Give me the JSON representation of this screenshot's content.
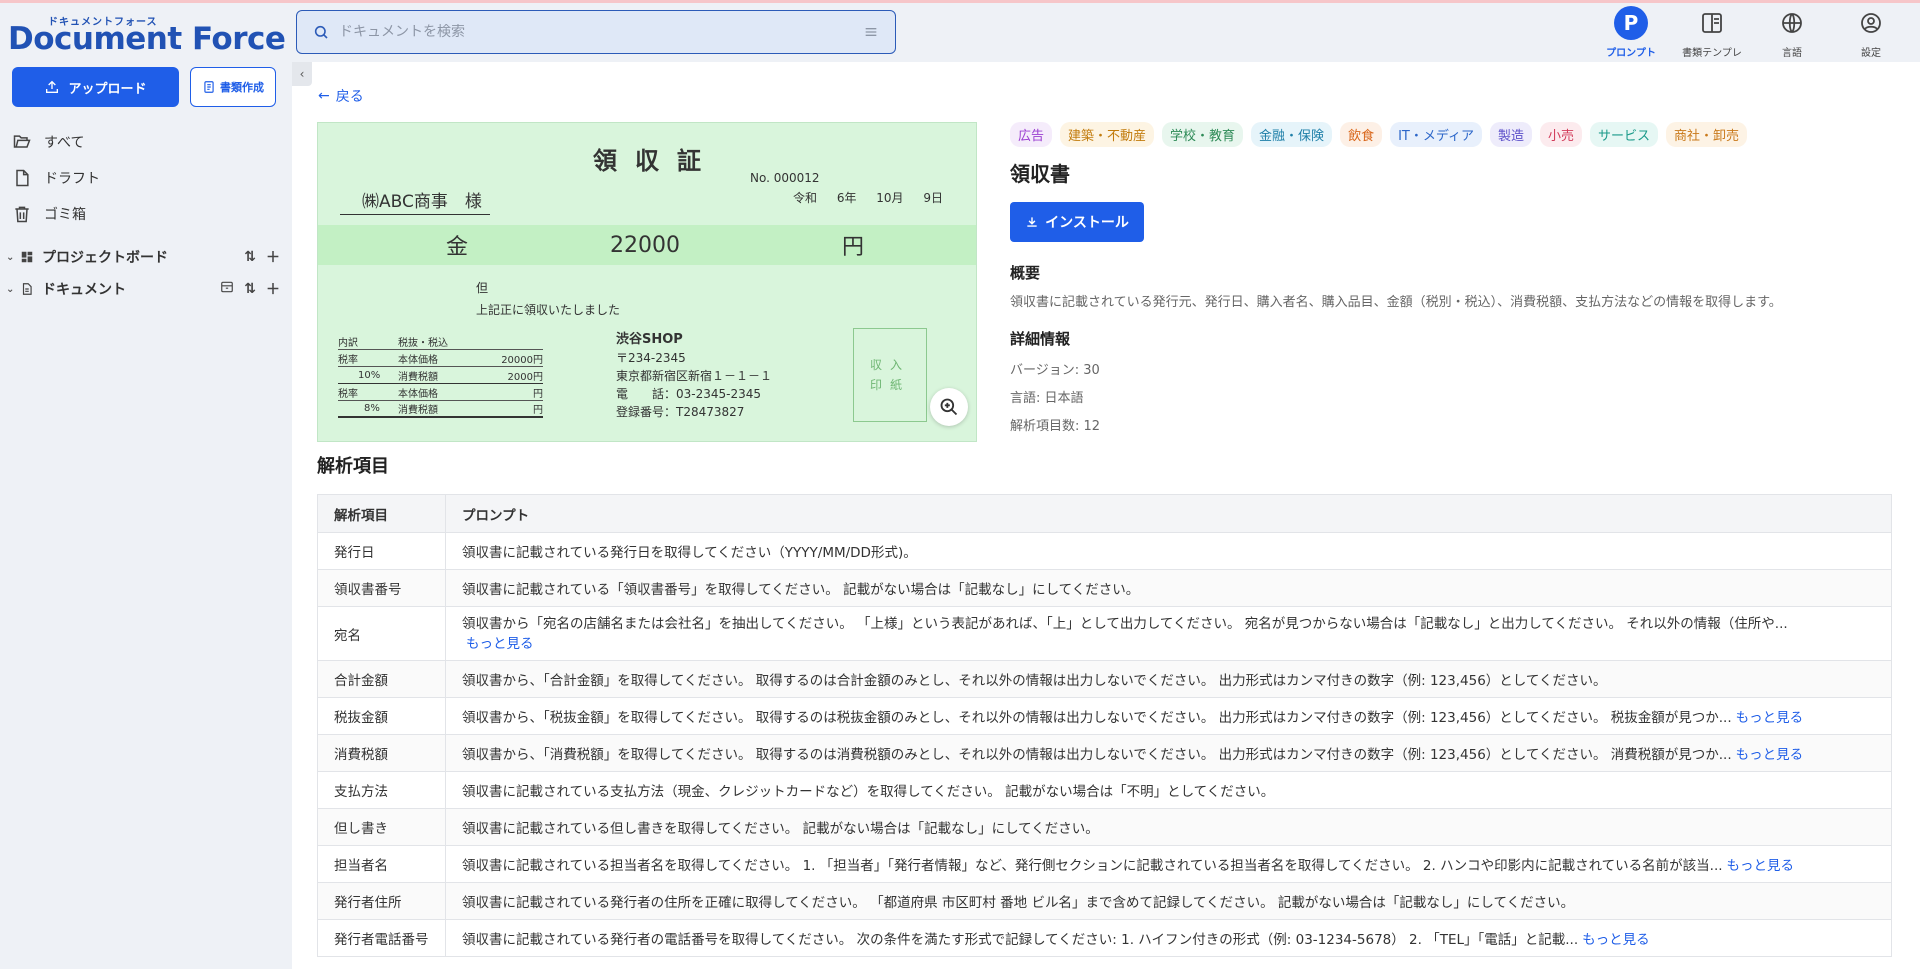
{
  "app": {
    "logo_kana": "ドキュメントフォース",
    "logo_main": "Document Force"
  },
  "sidebar": {
    "upload_label": "アップロード",
    "create_label": "書類作成",
    "nav": [
      {
        "label": "すべて",
        "icon": "folder-open-icon"
      },
      {
        "label": "ドラフト",
        "icon": "file-icon"
      },
      {
        "label": "ゴミ箱",
        "icon": "trash-icon"
      }
    ],
    "tree": [
      {
        "label": "プロジェクトボード",
        "icon": "dashboard-icon"
      },
      {
        "label": "ドキュメント",
        "icon": "document-icon"
      }
    ]
  },
  "search": {
    "placeholder": "ドキュメントを検索"
  },
  "topnav": [
    {
      "label": "プロンプト",
      "icon": "prompt-icon",
      "active": true
    },
    {
      "label": "書類テンプレ",
      "icon": "template-icon"
    },
    {
      "label": "言語",
      "icon": "globe-icon"
    },
    {
      "label": "設定",
      "icon": "user-settings-icon"
    }
  ],
  "main": {
    "back_label": "戻る"
  },
  "receipt": {
    "title": "領収証",
    "no": "No.   000012",
    "date": "令和 6年 10月 9日",
    "to": "㈱ABC商事　様",
    "kin": "金",
    "amount": "22000",
    "yen": "円",
    "tadashi": "但",
    "received": "上記正に領収いたしました",
    "table": {
      "head": [
        "内訳",
        "税抜・税込",
        ""
      ],
      "rows": [
        [
          "税率",
          "本体価格",
          "20000円"
        ],
        [
          "10%",
          "消費税額",
          "2000円"
        ],
        [
          "税率",
          "本体価格",
          "円"
        ],
        [
          "8%",
          "消費税額",
          "円"
        ]
      ]
    },
    "shop": {
      "name": "渋谷SHOP",
      "zip": "〒234-2345",
      "address": "東京都新宿区新宿１－１－１",
      "tel": "電　　話：03-2345-2345",
      "reg": "登録番号：T28473827"
    },
    "stamp_line1": "収入",
    "stamp_line2": "印紙"
  },
  "details": {
    "tags": [
      {
        "label": "広告",
        "color": "#9b3fd1",
        "bg": "#f5ecfb"
      },
      {
        "label": "建築・不動産",
        "color": "#c27c0e",
        "bg": "#fdf4e3"
      },
      {
        "label": "学校・教育",
        "color": "#2e8b57",
        "bg": "#e8f6ee"
      },
      {
        "label": "金融・保険",
        "color": "#1f7fa8",
        "bg": "#e6f4fa"
      },
      {
        "label": "飲食",
        "color": "#d9661a",
        "bg": "#fdf0e6"
      },
      {
        "label": "IT・メディア",
        "color": "#2c66c9",
        "bg": "#e8f0fc"
      },
      {
        "label": "製造",
        "color": "#5b4fc9",
        "bg": "#eeecfb"
      },
      {
        "label": "小売",
        "color": "#d23c5a",
        "bg": "#fcebee"
      },
      {
        "label": "サービス",
        "color": "#1a9a8a",
        "bg": "#e6f7f4"
      },
      {
        "label": "商社・卸売",
        "color": "#c9791a",
        "bg": "#fdf3e5"
      }
    ],
    "title": "領収書",
    "install_label": "インストール",
    "overview_heading": "概要",
    "overview_text": "領収書に記載されている発行元、発行日、購入者名、購入品目、金額（税別・税込）、消費税額、支払方法などの情報を取得します。",
    "detail_heading": "詳細情報",
    "version": "バージョン: 30",
    "language": "言語: 日本語",
    "item_count": "解析項目数: 12"
  },
  "analysis": {
    "title": "解析項目",
    "headers": [
      "解析項目",
      "プロンプト"
    ],
    "more_label": "もっと見る",
    "rows": [
      {
        "key": "発行日",
        "prompt": "領収書に記載されている発行日を取得してください（YYYY/MM/DD形式)。",
        "more": false
      },
      {
        "key": "領収書番号",
        "prompt": "領収書に記載されている「領収書番号」を取得してください。 記載がない場合は「記載なし」にしてください。",
        "more": false
      },
      {
        "key": "宛名",
        "prompt": "領収書から「宛名の店舗名または会社名」を抽出してください。 「上様」という表記があれば、「上」として出力してください。 宛名が見つからない場合は「記載なし」と出力してください。 それ以外の情報（住所や...",
        "more": true,
        "wrap": true
      },
      {
        "key": "合計金額",
        "prompt": "領収書から、「合計金額」を取得してください。 取得するのは合計金額のみとし、それ以外の情報は出力しないでください。 出力形式はカンマ付きの数字（例: 123,456）としてください。",
        "more": false
      },
      {
        "key": "税抜金額",
        "prompt": "領収書から、「税抜金額」を取得してください。 取得するのは税抜金額のみとし、それ以外の情報は出力しないでください。 出力形式はカンマ付きの数字（例: 123,456）としてください。 税抜金額が見つか...",
        "more": true
      },
      {
        "key": "消費税額",
        "prompt": "領収書から、「消費税額」を取得してください。 取得するのは消費税額のみとし、それ以外の情報は出力しないでください。 出力形式はカンマ付きの数字（例: 123,456）としてください。 消費税額が見つか...",
        "more": true
      },
      {
        "key": "支払方法",
        "prompt": "領収書に記載されている支払方法（現金、クレジットカードなど）を取得してください。 記載がない場合は「不明」としてください。",
        "more": false
      },
      {
        "key": "但し書き",
        "prompt": "領収書に記載されている但し書きを取得してください。 記載がない場合は「記載なし」にしてください。",
        "more": false
      },
      {
        "key": "担当者名",
        "prompt": "領収書に記載されている担当者名を取得してください。 1. 「担当者」「発行者情報」など、発行側セクションに記載されている担当者名を取得してください。 2. ハンコや印影内に記載されている名前が該当...",
        "more": true
      },
      {
        "key": "発行者住所",
        "prompt": "領収書に記載されている発行者の住所を正確に取得してください。 「都道府県 市区町村 番地 ビル名」まで含めて記録してください。 記載がない場合は「記載なし」にしてください。",
        "more": false
      },
      {
        "key": "発行者電話番号",
        "prompt": "領収書に記載されている発行者の電話番号を取得してください。 次の条件を満たす形式で記録してください: 1. ハイフン付きの形式（例: 03-1234-5678） 2. 「TEL」「電話」と記載...",
        "more": true
      }
    ]
  }
}
